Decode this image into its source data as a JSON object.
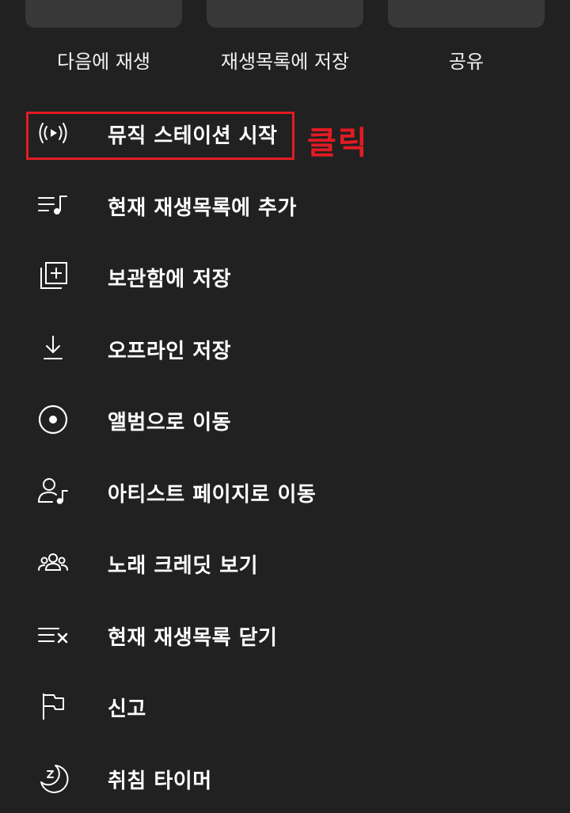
{
  "top_actions": [
    {
      "label": "다음에 재생"
    },
    {
      "label": "재생목록에 저장"
    },
    {
      "label": "공유"
    }
  ],
  "menu_items": [
    {
      "label": "뮤직 스테이션 시작",
      "icon": "radio-broadcast-icon"
    },
    {
      "label": "현재 재생목록에 추가",
      "icon": "queue-add-music-icon"
    },
    {
      "label": "보관함에 저장",
      "icon": "library-add-icon"
    },
    {
      "label": "오프라인 저장",
      "icon": "download-icon"
    },
    {
      "label": "앨범으로 이동",
      "icon": "album-icon"
    },
    {
      "label": "아티스트 페이지로 이동",
      "icon": "artist-icon"
    },
    {
      "label": "노래 크레딧 보기",
      "icon": "people-group-icon"
    },
    {
      "label": "현재 재생목록 닫기",
      "icon": "queue-close-icon"
    },
    {
      "label": "신고",
      "icon": "flag-icon"
    },
    {
      "label": "취침 타이머",
      "icon": "sleep-timer-icon"
    }
  ],
  "annotation": {
    "text": "클릭",
    "color": "#e31b23"
  },
  "colors": {
    "background": "#212121",
    "tile": "#383838",
    "text": "#ffffff",
    "highlight": "#e31b23"
  }
}
